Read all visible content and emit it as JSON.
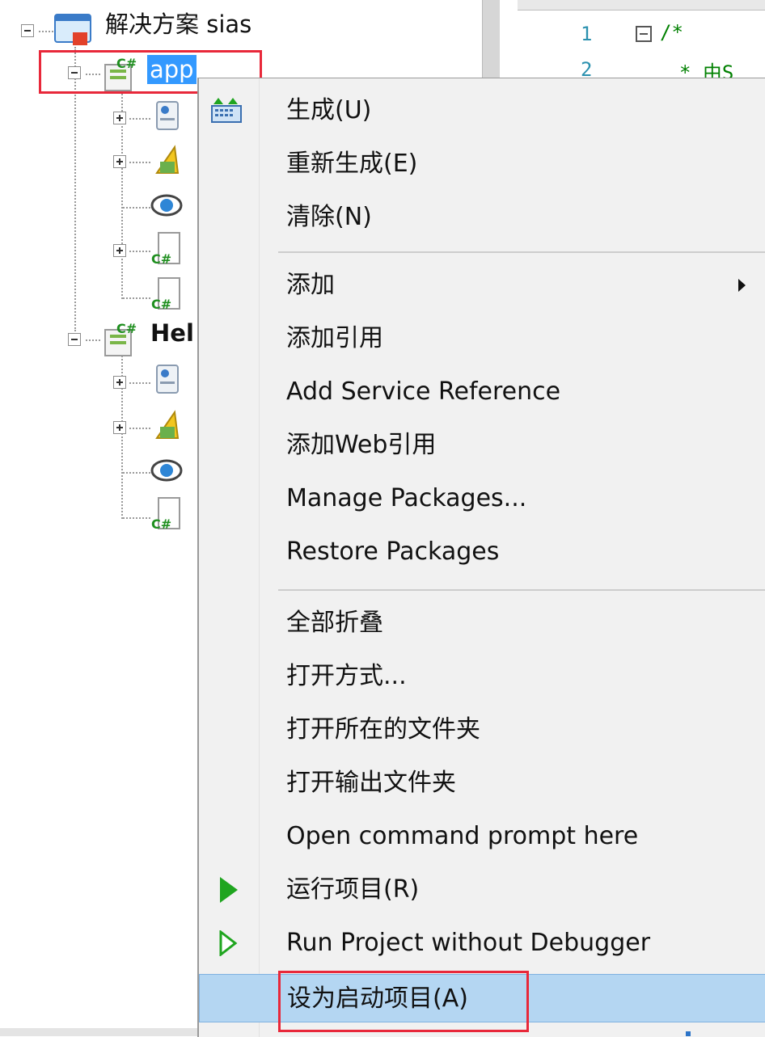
{
  "solution_tree": {
    "solution_label": "解决方案 sias",
    "project_app_label": "app",
    "project_hel_label": "Hel"
  },
  "editor": {
    "line_numbers": [
      "1",
      "2"
    ],
    "lines": [
      "/*",
      "* 由S"
    ]
  },
  "context_menu": {
    "items": [
      {
        "label": "生成(U)"
      },
      {
        "label": "重新生成(E)"
      },
      {
        "label": "清除(N)"
      },
      {
        "label": "添加"
      },
      {
        "label": "添加引用"
      },
      {
        "label": "Add Service Reference"
      },
      {
        "label": "添加Web引用"
      },
      {
        "label": "Manage Packages..."
      },
      {
        "label": "Restore Packages"
      },
      {
        "label": "全部折叠"
      },
      {
        "label": "打开方式..."
      },
      {
        "label": "打开所在的文件夹"
      },
      {
        "label": "打开输出文件夹"
      },
      {
        "label": "Open command prompt here"
      },
      {
        "label": "运行项目(R)"
      },
      {
        "label": "Run Project without Debugger"
      },
      {
        "label": "设为启动项目(A)"
      }
    ]
  },
  "colors": {
    "selection_blue": "#3399ff",
    "highlight_red": "#e8283a",
    "menu_active": "#b4d6f2",
    "run_green": "#1fa51f"
  },
  "icons": {
    "solution": "solution-icon",
    "project": "csharp-project-icon",
    "properties": "properties-icon",
    "references": "references-icon",
    "web": "web-reference-icon",
    "file": "csharp-file-icon",
    "build": "build-icon",
    "run": "run-icon",
    "run_no_debug": "run-without-debugger-icon",
    "submenu": "submenu-arrow-icon"
  }
}
